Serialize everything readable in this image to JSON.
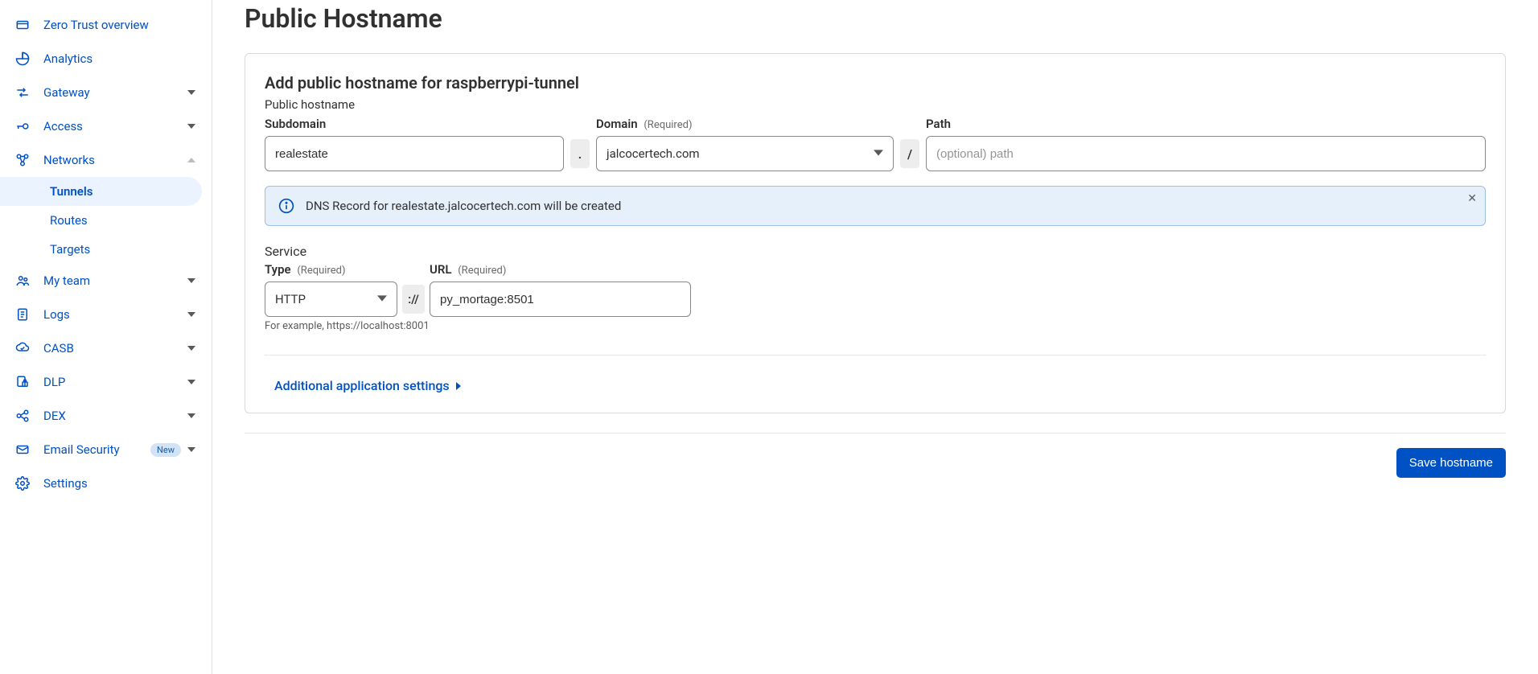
{
  "sidebar": {
    "items": [
      {
        "id": "overview",
        "label": "Zero Trust overview",
        "icon": "overview",
        "expandable": false
      },
      {
        "id": "analytics",
        "label": "Analytics",
        "icon": "analytics",
        "expandable": false
      },
      {
        "id": "gateway",
        "label": "Gateway",
        "icon": "gateway",
        "expandable": true
      },
      {
        "id": "access",
        "label": "Access",
        "icon": "access",
        "expandable": true
      },
      {
        "id": "networks",
        "label": "Networks",
        "icon": "networks",
        "expandable": true,
        "expanded": true,
        "children": [
          {
            "id": "tunnels",
            "label": "Tunnels",
            "active": true
          },
          {
            "id": "routes",
            "label": "Routes",
            "active": false
          },
          {
            "id": "targets",
            "label": "Targets",
            "active": false
          }
        ]
      },
      {
        "id": "myteam",
        "label": "My team",
        "icon": "myteam",
        "expandable": true
      },
      {
        "id": "logs",
        "label": "Logs",
        "icon": "logs",
        "expandable": true
      },
      {
        "id": "casb",
        "label": "CASB",
        "icon": "casb",
        "expandable": true
      },
      {
        "id": "dlp",
        "label": "DLP",
        "icon": "dlp",
        "expandable": true
      },
      {
        "id": "dex",
        "label": "DEX",
        "icon": "dex",
        "expandable": true
      },
      {
        "id": "emailsec",
        "label": "Email Security",
        "icon": "email",
        "expandable": true,
        "badge": "New"
      },
      {
        "id": "settings",
        "label": "Settings",
        "icon": "settings",
        "expandable": false
      }
    ]
  },
  "page": {
    "title": "Public Hostname",
    "panel_title": "Add public hostname for raspberrypi-tunnel",
    "panel_subtitle": "Public hostname",
    "subdomain": {
      "label": "Subdomain",
      "value": "realestate"
    },
    "domain": {
      "label": "Domain",
      "required": "(Required)",
      "value": "jalcocertech.com"
    },
    "path": {
      "label": "Path",
      "placeholder": "(optional) path",
      "value": ""
    },
    "info": "DNS Record for realestate.jalcocertech.com will be created",
    "service_label": "Service",
    "type": {
      "label": "Type",
      "required": "(Required)",
      "value": "HTTP"
    },
    "proto_separator": "://",
    "url": {
      "label": "URL",
      "required": "(Required)",
      "value": "py_mortage:8501"
    },
    "hint": "For example, https://localhost:8001",
    "additional_link": "Additional application settings",
    "save_button": "Save hostname"
  }
}
